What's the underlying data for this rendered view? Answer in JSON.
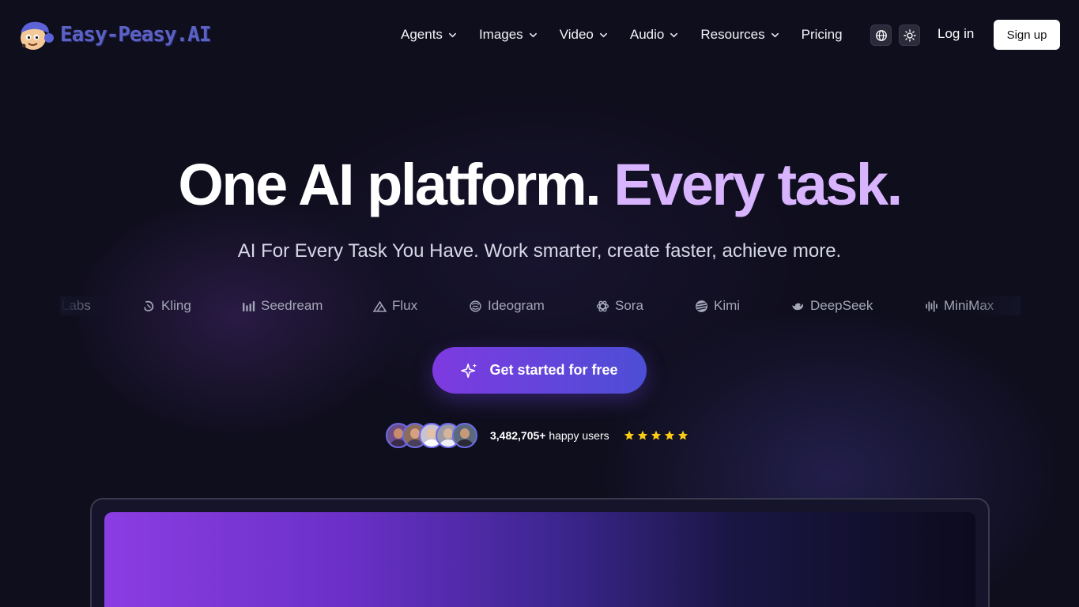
{
  "header": {
    "logo_text": "Easy-Peasy.AI",
    "nav": [
      {
        "label": "Agents",
        "has_dropdown": true
      },
      {
        "label": "Images",
        "has_dropdown": true
      },
      {
        "label": "Video",
        "has_dropdown": true
      },
      {
        "label": "Audio",
        "has_dropdown": true
      },
      {
        "label": "Resources",
        "has_dropdown": true
      },
      {
        "label": "Pricing",
        "has_dropdown": false
      }
    ],
    "language_icon": "globe-icon",
    "theme_icon": "sun-icon",
    "login_label": "Log in",
    "signup_label": "Sign up"
  },
  "hero": {
    "title_part1": "One AI platform. ",
    "title_part2": "Every task.",
    "subtitle": "AI For Every Task You Have. Work smarter, create faster, achieve more."
  },
  "models": [
    {
      "name": "Labs",
      "icon": "none"
    },
    {
      "name": "Kling",
      "icon": "kling-icon"
    },
    {
      "name": "Seedream",
      "icon": "seedream-icon"
    },
    {
      "name": "Flux",
      "icon": "flux-icon"
    },
    {
      "name": "Ideogram",
      "icon": "ideogram-icon"
    },
    {
      "name": "Sora",
      "icon": "sora-icon"
    },
    {
      "name": "Kimi",
      "icon": "kimi-icon"
    },
    {
      "name": "DeepSeek",
      "icon": "deepseek-icon"
    },
    {
      "name": "MiniMax",
      "icon": "minimax-icon"
    }
  ],
  "cta": {
    "label": "Get started for free",
    "icon": "sparkles-icon"
  },
  "social_proof": {
    "count": "3,482,705+",
    "suffix": " happy users",
    "rating": 5
  },
  "colors": {
    "background": "#0f0e1d",
    "accent_purple": "#d8b4fe",
    "cta_start": "#7e3ae0",
    "cta_end": "#4c4ed6",
    "star": "#facc15"
  }
}
